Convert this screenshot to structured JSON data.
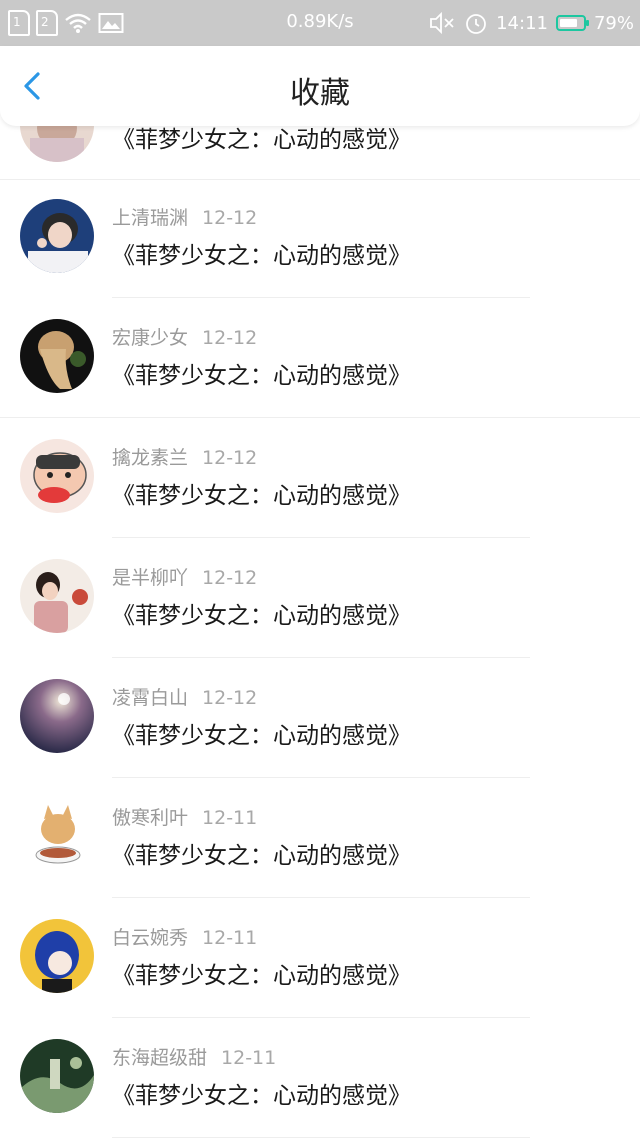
{
  "status_bar": {
    "sim1": "1",
    "sim2": "2",
    "speed": "0.89K/s",
    "time": "14:11",
    "battery": "79%",
    "battery_level": 0.79
  },
  "header": {
    "title": "收藏"
  },
  "partial_item": {
    "content": "《菲梦少女之：心动的感觉》"
  },
  "items": [
    {
      "name": "上清瑞渊",
      "date": "12-12",
      "content": "《菲梦少女之：心动的感觉》"
    },
    {
      "name": "宏康少女",
      "date": "12-12",
      "content": "《菲梦少女之：心动的感觉》"
    },
    {
      "name": "擒龙素兰",
      "date": "12-12",
      "content": "《菲梦少女之：心动的感觉》"
    },
    {
      "name": "是半柳吖",
      "date": "12-12",
      "content": "《菲梦少女之：心动的感觉》"
    },
    {
      "name": "凌霄白山",
      "date": "12-12",
      "content": "《菲梦少女之：心动的感觉》"
    },
    {
      "name": "傲寒利叶",
      "date": "12-11",
      "content": "《菲梦少女之：心动的感觉》"
    },
    {
      "name": "白云婉秀",
      "date": "12-11",
      "content": "《菲梦少女之：心动的感觉》"
    },
    {
      "name": "东海超级甜",
      "date": "12-11",
      "content": "《菲梦少女之：心动的感觉》"
    }
  ],
  "colors": {
    "accent": "#2b97e6",
    "status_bar_bg": "#c9c9c9",
    "battery": "#1cc7a0"
  }
}
